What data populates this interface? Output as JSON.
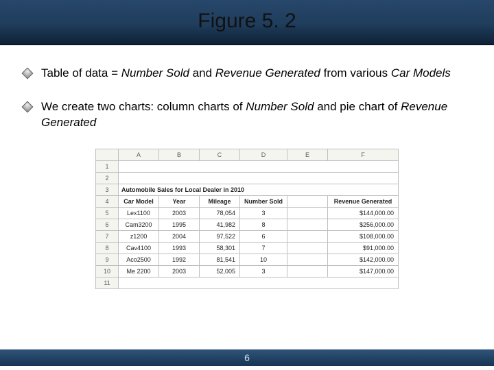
{
  "slide": {
    "title": "Figure 5. 2",
    "page_number": "6",
    "bullets": [
      {
        "pre": "Table of data = ",
        "i1": "Number Sold",
        "mid": " and ",
        "i2": "Revenue Generated",
        "post": " from various ",
        "i3": "Car Models",
        "tail": ""
      },
      {
        "pre": "We create two charts: column charts of ",
        "i1": "Number Sold",
        "mid": " and pie chart of ",
        "i2": "Revenue Generated",
        "post": "",
        "i3": "",
        "tail": ""
      }
    ]
  },
  "spreadsheet": {
    "columns": [
      "A",
      "B",
      "C",
      "D",
      "E",
      "F"
    ],
    "row_numbers": [
      "1",
      "2",
      "3",
      "4",
      "5",
      "6",
      "7",
      "8",
      "9",
      "10",
      "11"
    ],
    "table_title": "Automobile Sales for Local Dealer in 2010",
    "headers": [
      "Car Model",
      "Year",
      "Mileage",
      "Number Sold",
      "",
      "Revenue Generated"
    ],
    "rows": [
      [
        "Lex1100",
        "2003",
        "78,054",
        "3",
        "",
        "$144,000.00"
      ],
      [
        "Cam3200",
        "1995",
        "41,982",
        "8",
        "",
        "$256,000.00"
      ],
      [
        "z1200",
        "2004",
        "97,522",
        "6",
        "",
        "$108,000.00"
      ],
      [
        "Cav4100",
        "1993",
        "58,301",
        "7",
        "",
        "$91,000.00"
      ],
      [
        "Aco2500",
        "1992",
        "81,541",
        "10",
        "",
        "$142,000.00"
      ],
      [
        "Me 2200",
        "2003",
        "52,005",
        "3",
        "",
        "$147,000.00"
      ]
    ]
  },
  "chart_data": {
    "type": "table",
    "title": "Automobile Sales for Local Dealer in 2010",
    "columns": [
      "Car Model",
      "Year",
      "Mileage",
      "Number Sold",
      "Revenue Generated"
    ],
    "rows": [
      [
        "Lex1100",
        2003,
        78054,
        3,
        144000.0
      ],
      [
        "Cam3200",
        1995,
        41982,
        8,
        256000.0
      ],
      [
        "z1200",
        2004,
        97522,
        6,
        108000.0
      ],
      [
        "Cav4100",
        1993,
        58301,
        7,
        91000.0
      ],
      [
        "Aco2500",
        1992,
        81541,
        10,
        142000.0
      ],
      [
        "Me 2200",
        2003,
        52005,
        3,
        147000.0
      ]
    ]
  }
}
